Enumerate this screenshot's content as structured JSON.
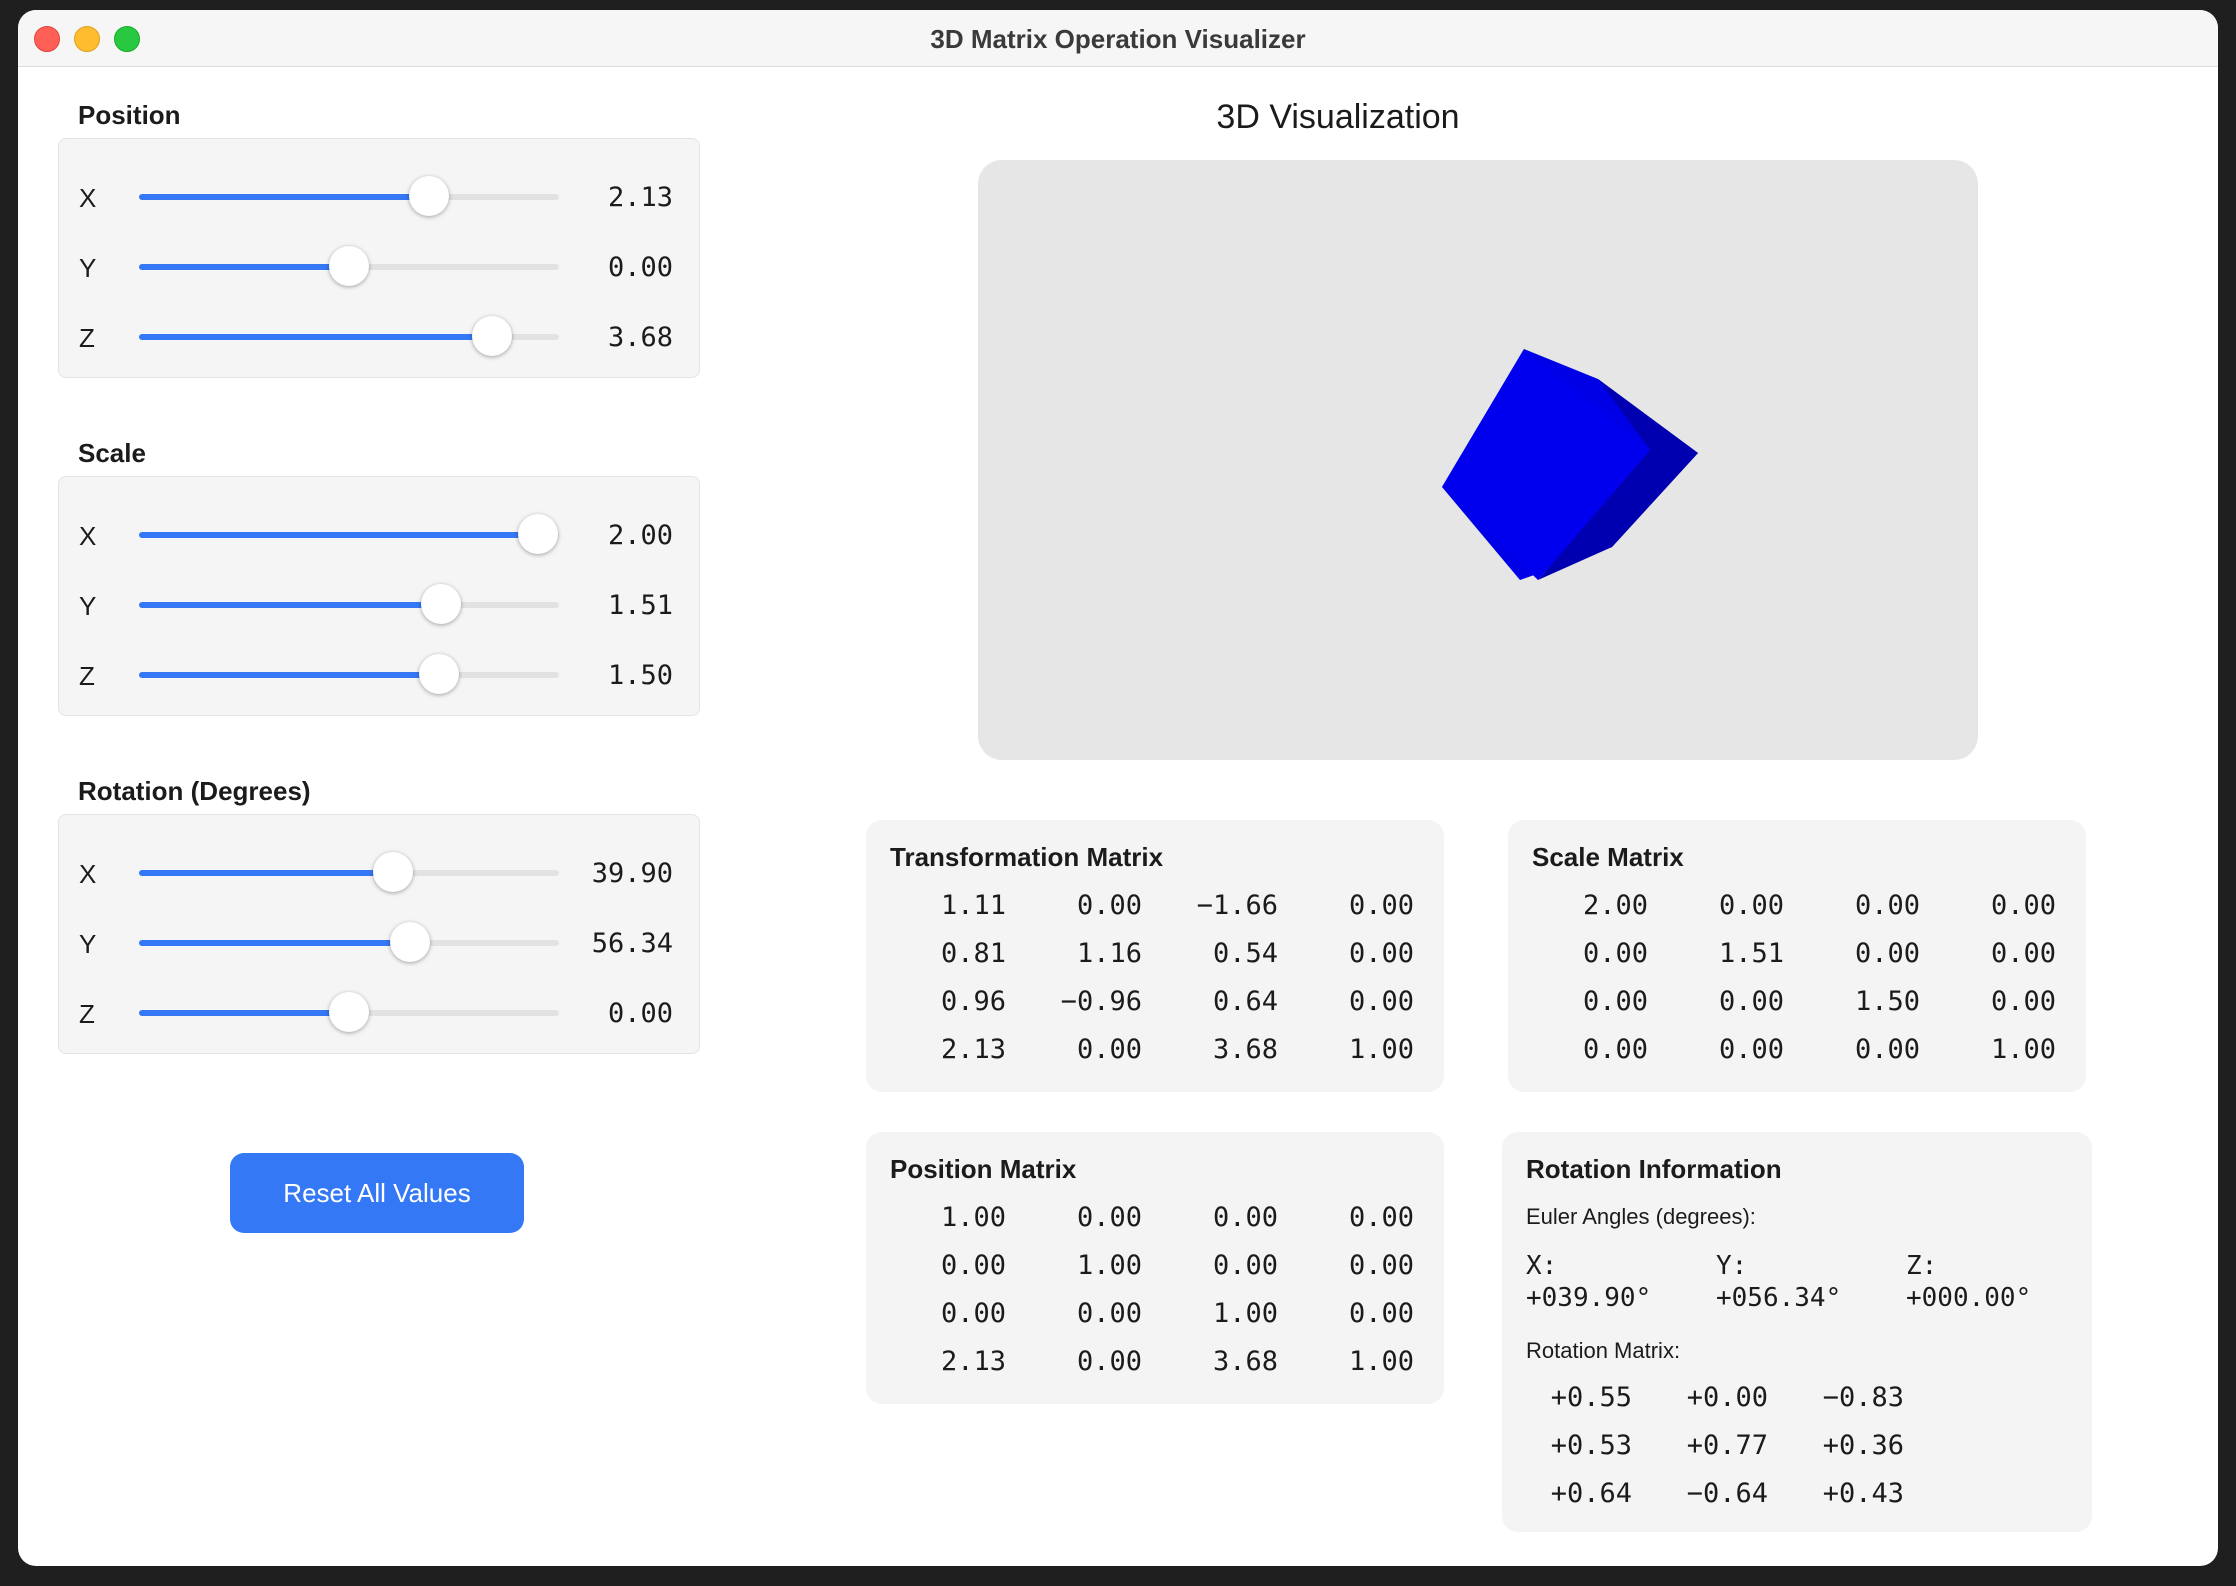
{
  "window": {
    "title": "3D Matrix Operation Visualizer"
  },
  "position": {
    "title": "Position",
    "sliders": [
      {
        "label": "X",
        "value": "2.13",
        "fraction": 0.69
      },
      {
        "label": "Y",
        "value": "0.00",
        "fraction": 0.5
      },
      {
        "label": "Z",
        "value": "3.68",
        "fraction": 0.84
      }
    ]
  },
  "scale": {
    "title": "Scale",
    "sliders": [
      {
        "label": "X",
        "value": "2.00",
        "fraction": 0.95
      },
      {
        "label": "Y",
        "value": "1.51",
        "fraction": 0.72
      },
      {
        "label": "Z",
        "value": "1.50",
        "fraction": 0.715
      }
    ]
  },
  "rotation": {
    "title": "Rotation (Degrees)",
    "sliders": [
      {
        "label": "X",
        "value": "39.90",
        "fraction": 0.605
      },
      {
        "label": "Y",
        "value": "56.34",
        "fraction": 0.645
      },
      {
        "label": "Z",
        "value": "0.00",
        "fraction": 0.5
      }
    ]
  },
  "reset_label": "Reset All Values",
  "visualization": {
    "title": "3D Visualization",
    "cube_color": "#0000ee",
    "background": "#e6e6e6"
  },
  "transformation_matrix": {
    "title": "Transformation Matrix",
    "rows": [
      [
        "1.11",
        "0.00",
        "−1.66",
        "0.00"
      ],
      [
        "0.81",
        "1.16",
        "0.54",
        "0.00"
      ],
      [
        "0.96",
        "−0.96",
        "0.64",
        "0.00"
      ],
      [
        "2.13",
        "0.00",
        "3.68",
        "1.00"
      ]
    ]
  },
  "scale_matrix": {
    "title": "Scale Matrix",
    "rows": [
      [
        "2.00",
        "0.00",
        "0.00",
        "0.00"
      ],
      [
        "0.00",
        "1.51",
        "0.00",
        "0.00"
      ],
      [
        "0.00",
        "0.00",
        "1.50",
        "0.00"
      ],
      [
        "0.00",
        "0.00",
        "0.00",
        "1.00"
      ]
    ]
  },
  "position_matrix": {
    "title": "Position Matrix",
    "rows": [
      [
        "1.00",
        "0.00",
        "0.00",
        "0.00"
      ],
      [
        "0.00",
        "1.00",
        "0.00",
        "0.00"
      ],
      [
        "0.00",
        "0.00",
        "1.00",
        "0.00"
      ],
      [
        "2.13",
        "0.00",
        "3.68",
        "1.00"
      ]
    ]
  },
  "rotation_info": {
    "title": "Rotation Information",
    "euler_label": "Euler Angles (degrees):",
    "euler": [
      {
        "axis": "X:",
        "value": "+039.90°"
      },
      {
        "axis": "Y:",
        "value": "+056.34°"
      },
      {
        "axis": "Z:",
        "value": "+000.00°"
      }
    ],
    "matrix_label": "Rotation Matrix:",
    "rows": [
      [
        "+0.55",
        "+0.00",
        "−0.83"
      ],
      [
        "+0.53",
        "+0.77",
        "+0.36"
      ],
      [
        "+0.64",
        "−0.64",
        "+0.43"
      ]
    ]
  }
}
